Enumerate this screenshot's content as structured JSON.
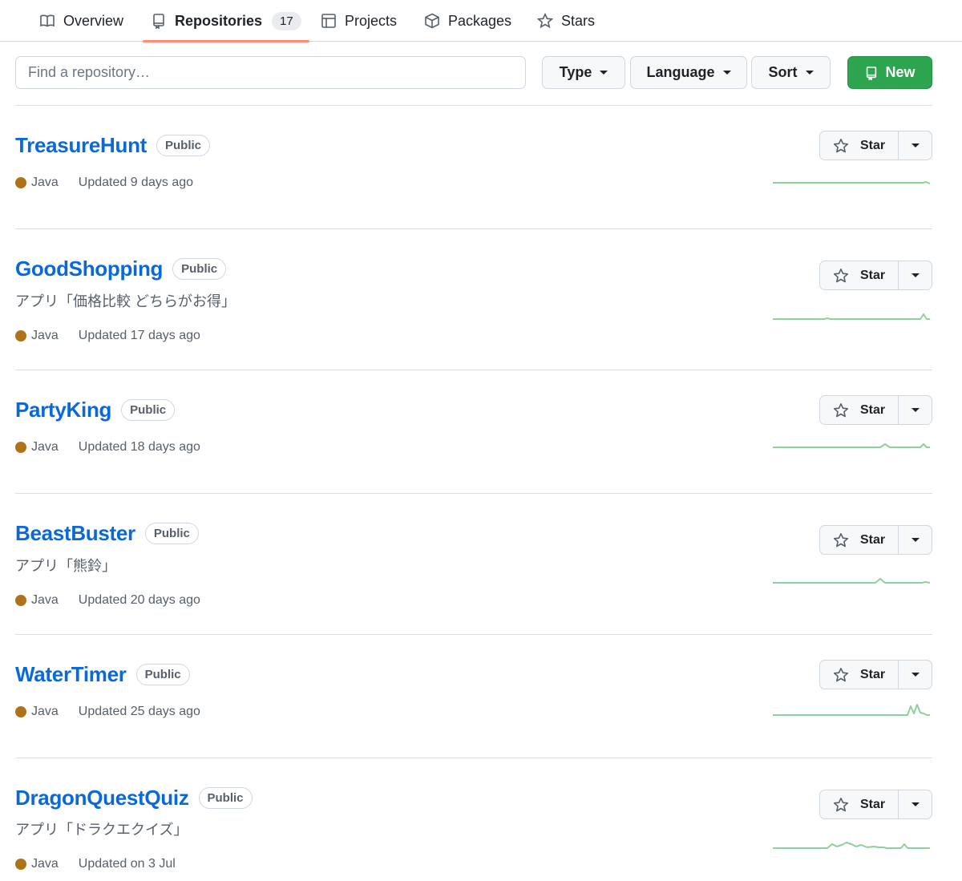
{
  "tabs": [
    {
      "label": "Overview",
      "icon": "book-icon"
    },
    {
      "label": "Repositories",
      "icon": "repo-icon",
      "count": "17",
      "active": true
    },
    {
      "label": "Projects",
      "icon": "table-icon"
    },
    {
      "label": "Packages",
      "icon": "package-icon"
    },
    {
      "label": "Stars",
      "icon": "star-icon"
    }
  ],
  "filters": {
    "search_placeholder": "Find a repository…",
    "type_label": "Type",
    "language_label": "Language",
    "sort_label": "Sort",
    "new_label": "New"
  },
  "colors": {
    "link": "#0969da",
    "java": "#b07219",
    "new_button": "#2da44e",
    "sparkline": "#8fd19e"
  },
  "repos": [
    {
      "name": "TreasureHunt",
      "visibility": "Public",
      "description": "",
      "language": "Java",
      "updated": "Updated 9 days ago",
      "star_label": "Star"
    },
    {
      "name": "GoodShopping",
      "visibility": "Public",
      "description": "アプリ「価格比較 どちらがお得」",
      "language": "Java",
      "updated": "Updated 17 days ago",
      "star_label": "Star"
    },
    {
      "name": "PartyKing",
      "visibility": "Public",
      "description": "",
      "language": "Java",
      "updated": "Updated 18 days ago",
      "star_label": "Star"
    },
    {
      "name": "BeastBuster",
      "visibility": "Public",
      "description": "アプリ「熊鈴」",
      "language": "Java",
      "updated": "Updated 20 days ago",
      "star_label": "Star"
    },
    {
      "name": "WaterTimer",
      "visibility": "Public",
      "description": "",
      "language": "Java",
      "updated": "Updated 25 days ago",
      "star_label": "Star"
    },
    {
      "name": "DragonQuestQuiz",
      "visibility": "Public",
      "description": "アプリ「ドラクエクイズ」",
      "language": "Java",
      "updated": "Updated on 3 Jul",
      "star_label": "Star"
    }
  ]
}
